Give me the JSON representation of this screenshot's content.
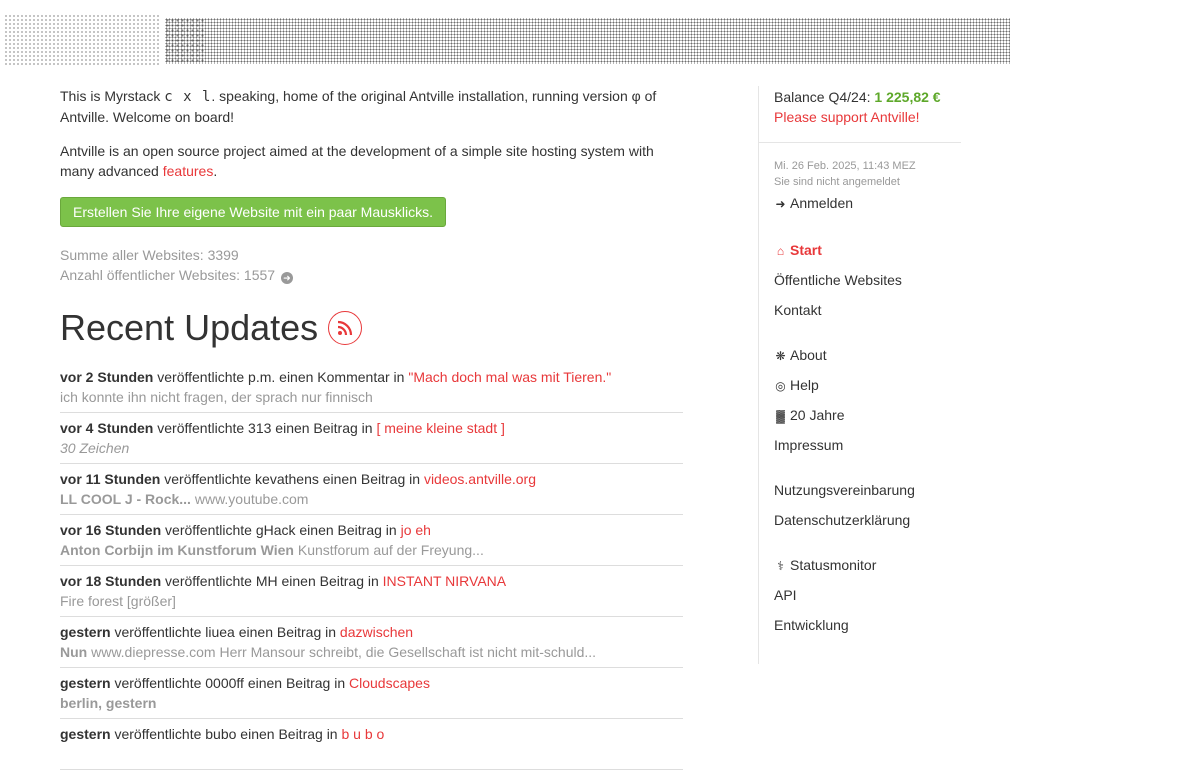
{
  "intro": {
    "p1_pre": "This is Myrstack ",
    "p1_mono": "c x l",
    "p1_post": ". speaking, home of the original Antville installation, running version φ of Antville. Welcome on board!",
    "p2_pre": "Antville is an open source project aimed at the development of a simple site hosting system with many advanced ",
    "p2_link": "features",
    "p2_post": "."
  },
  "cta_label": "Erstellen Sie Ihre eigene Website mit ein paar Mausklicks.",
  "stats": {
    "total": "Summe aller Websites: 3399",
    "public": "Anzahl öffentlicher Websites: 1557"
  },
  "recent_title": "Recent Updates",
  "updates": [
    {
      "when": "vor 2 Stunden",
      "action": " veröffentlichte p.m. einen Kommentar in ",
      "site": "\"Mach doch mal was mit Tieren.\"",
      "detail_bold": "",
      "detail": "ich konnte ihn nicht fragen, der sprach nur finnisch",
      "italic": false
    },
    {
      "when": "vor 4 Stunden",
      "action": " veröffentlichte 313 einen Beitrag in ",
      "site": "[ meine kleine stadt ]",
      "detail_bold": "",
      "detail": "30 Zeichen",
      "italic": true
    },
    {
      "when": "vor 11 Stunden",
      "action": " veröffentlichte kevathens einen Beitrag in ",
      "site": "videos.antville.org",
      "detail_bold": "LL COOL J - Rock...",
      "detail": " www.youtube.com",
      "italic": false
    },
    {
      "when": "vor 16 Stunden",
      "action": " veröffentlichte gHack einen Beitrag in ",
      "site": "jo eh",
      "detail_bold": "Anton Corbijn im Kunstforum Wien",
      "detail": " Kunstforum auf der Freyung...",
      "italic": false
    },
    {
      "when": "vor 18 Stunden",
      "action": " veröffentlichte MH einen Beitrag in ",
      "site": "INSTANT NIRVANA",
      "detail_bold": "",
      "detail": "Fire forest [größer]",
      "italic": false
    },
    {
      "when": "gestern",
      "action": " veröffentlichte liuea einen Beitrag in ",
      "site": "dazwischen",
      "detail_bold": "Nun",
      "detail": " www.diepresse.com Herr Mansour schreibt, die Gesellschaft ist nicht mit-schuld...",
      "italic": false
    },
    {
      "when": "gestern",
      "action": " veröffentlichte 0000ff einen Beitrag in ",
      "site": "Cloudscapes",
      "detail_bold": "berlin, gestern",
      "detail": "",
      "italic": false
    },
    {
      "when": "gestern",
      "action": " veröffentlichte bubo einen Beitrag in ",
      "site": "b u b o",
      "detail_bold": "",
      "detail": "",
      "italic": false
    }
  ],
  "sidebar": {
    "balance_label": "Balance Q4/24: ",
    "balance_amount": "1 225,82 €",
    "support": "Please support Antville!",
    "date": "Mi. 26 Feb. 2025, 11:43 MEZ",
    "login_status": "Sie sind nicht angemeldet",
    "login": "Anmelden",
    "nav1": [
      "Start",
      "Öffentliche Websites",
      "Kontakt"
    ],
    "nav2": [
      "About",
      "Help",
      "20 Jahre",
      "Impressum"
    ],
    "nav3": [
      "Nutzungsvereinbarung",
      "Datenschutzerklärung"
    ],
    "nav4": [
      "Statusmonitor",
      "API",
      "Entwicklung"
    ]
  },
  "colors": {
    "accent": "#e8383a",
    "green": "#7cc24a",
    "balance_green": "#5ea82a",
    "muted": "#999999"
  }
}
